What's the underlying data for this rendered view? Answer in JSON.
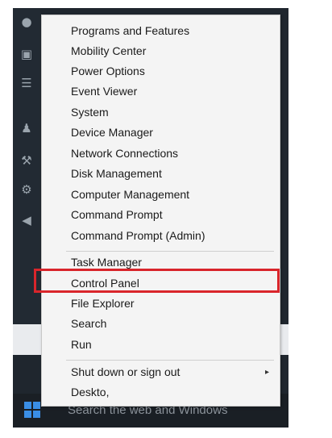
{
  "taskbar": {
    "search_placeholder": "Search the web and Windows"
  },
  "sidebar_icons": [
    "people-icon",
    "chat-icon",
    "list-icon",
    "person-icon",
    "wrench-icon",
    "gear-icon",
    "back-arrow-icon"
  ],
  "menu": {
    "groups": [
      {
        "items": [
          {
            "label": "Programs and Features"
          },
          {
            "label": "Mobility Center"
          },
          {
            "label": "Power Options"
          },
          {
            "label": "Event Viewer"
          },
          {
            "label": "System"
          },
          {
            "label": "Device Manager"
          },
          {
            "label": "Network Connections"
          },
          {
            "label": "Disk Management"
          },
          {
            "label": "Computer Management"
          },
          {
            "label": "Command Prompt"
          },
          {
            "label": "Command Prompt (Admin)"
          }
        ]
      },
      {
        "items": [
          {
            "label": "Task Manager"
          },
          {
            "label": "Control Panel",
            "highlighted": true
          },
          {
            "label": "File Explorer"
          },
          {
            "label": "Search"
          },
          {
            "label": "Run"
          }
        ]
      },
      {
        "items": [
          {
            "label": "Shut down or sign out",
            "has_submenu": true
          },
          {
            "label": "Deskto,"
          }
        ]
      }
    ]
  },
  "colors": {
    "highlight_border": "#d9252b",
    "menu_background": "#f4f4f4",
    "desktop_background": "#1f262e",
    "start_button": "#3a8ee6"
  }
}
